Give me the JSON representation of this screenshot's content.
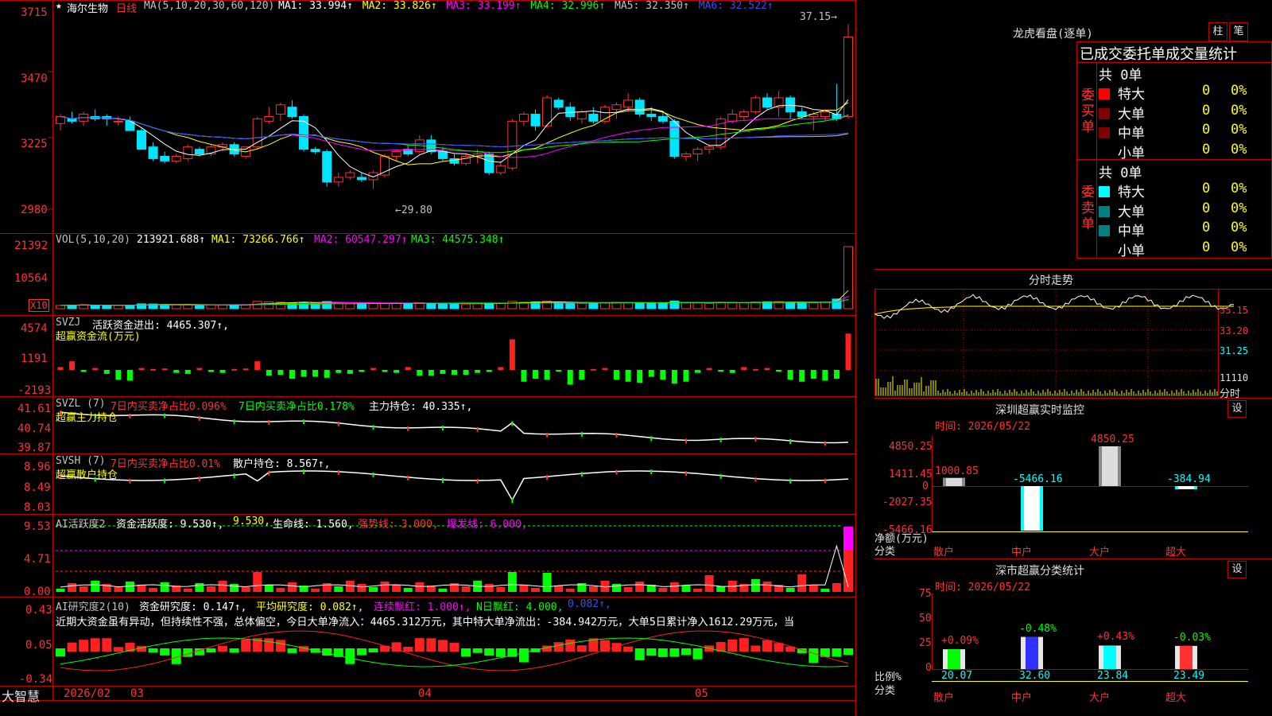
{
  "colors": {
    "up": "#ff3232",
    "down": "#00e5ff",
    "grid": "#c00000",
    "ma1": "#ffffff",
    "ma2": "#ffff00",
    "ma3": "#ff00ff",
    "ma4": "#00ff00",
    "ma5": "#c0c0c0",
    "ma6": "#3050ff"
  },
  "header": {
    "star": "★",
    "stock_name": "海尔生物",
    "period": "日线",
    "ma_label": "MA(5,10,20,30,60,120)",
    "ma_items": [
      {
        "label": "MA1: 33.994↑",
        "color": "#ffffff"
      },
      {
        "label": "MA2: 33.826↑",
        "color": "#ffff00"
      },
      {
        "label": "MA3: 33.199↑",
        "color": "#ff00ff"
      },
      {
        "label": "MA4: 32.996↑",
        "color": "#00ff00"
      },
      {
        "label": "MA5: 32.350↑",
        "color": "#c0c0c0"
      },
      {
        "label": "MA6: 32.522↑",
        "color": "#3050ff"
      }
    ],
    "high_mark": "37.15→",
    "low_mark": "←29.80"
  },
  "price_axis": {
    "ticks": [
      "3715",
      "3470",
      "3225",
      "2980"
    ]
  },
  "vol_panel": {
    "label": "VOL(5,10,20)",
    "value": "213921.688↑",
    "ma1": "MA1: 73266.766↑",
    "ma2": "MA2: 60547.297↑",
    "ma3": "MA3: 44575.348↑",
    "ticks": [
      "21392",
      "10564"
    ],
    "unit": "X10"
  },
  "svzj_panel": {
    "label": "SVZJ",
    "title": "活跃资金进出: 4465.307↑,",
    "subtitle": "超赢资金流(万元)",
    "ticks": [
      "4574",
      "1191",
      "-2193"
    ]
  },
  "svzl_panel": {
    "label": "SVZL (7)",
    "t1": "7日内买卖净占比0.096%",
    "t2": "7日内买卖净占比0.178%",
    "t3": "主力持仓: 40.335↑,",
    "subtitle": "超赢主力持仓",
    "ticks": [
      "41.61",
      "40.74",
      "39.87"
    ]
  },
  "svsh_panel": {
    "label": "SVSH (7)",
    "t1": "7日内买卖净占比0.01%",
    "t2": "散户持仓: 8.567↑,",
    "subtitle": "超赢散户持仓",
    "ticks": [
      "8.96",
      "8.49",
      "8.03"
    ]
  },
  "ai_active_panel": {
    "label": "AI活跃度2",
    "t1": "资金活跃度: 9.530↑,",
    "t2": "9.530,",
    "t3": "生命线: 1.560,",
    "t4": "强势线: 3.000,",
    "t5": "爆发线: 6.000,",
    "ticks": [
      "9.53",
      "4.71",
      "0.00"
    ]
  },
  "ai_research_panel": {
    "label": "AI研究度2(10)",
    "t1": "资金研究度: 0.147↑,",
    "t2": "平均研究度: 0.082↑,",
    "t3": "连续飘红: 1.000↑,",
    "t4": "N日飘红: 4.000,",
    "t5": "0.082↑,",
    "commentary": "近期大资金虽有异动，但持续性不强，总体偏空，今日大单净流入：4465.312万元，其中特大单净流出：-384.942万元，大单5日累计净入1612.29万元，当",
    "ticks": [
      "0.43",
      "0.05",
      "-0.34"
    ]
  },
  "date_axis": {
    "brand": "大智慧",
    "labels": [
      "2026/02",
      "03",
      "04",
      "05"
    ]
  },
  "chart_data": [
    {
      "type": "candlestick",
      "title": "海尔生物 日线",
      "ylim": [
        29.0,
        37.5
      ],
      "ohlc": [
        [
          32.9,
          33.3,
          32.6,
          33.2
        ],
        [
          33.1,
          33.4,
          32.9,
          33.0
        ],
        [
          33.0,
          33.4,
          32.8,
          33.3
        ],
        [
          33.2,
          33.5,
          33.0,
          33.1
        ],
        [
          33.2,
          33.3,
          32.8,
          33.1
        ],
        [
          33.0,
          33.2,
          32.8,
          33.0
        ],
        [
          33.0,
          33.2,
          32.6,
          32.6
        ],
        [
          32.6,
          32.7,
          31.8,
          31.8
        ],
        [
          31.9,
          32.1,
          31.3,
          31.4
        ],
        [
          31.5,
          31.7,
          31.2,
          31.3
        ],
        [
          31.3,
          31.6,
          31.2,
          31.5
        ],
        [
          31.4,
          32.0,
          31.3,
          31.9
        ],
        [
          31.8,
          31.9,
          31.5,
          31.6
        ],
        [
          31.6,
          32.0,
          31.5,
          31.9
        ],
        [
          31.9,
          32.1,
          31.7,
          32.0
        ],
        [
          32.0,
          32.1,
          31.5,
          31.6
        ],
        [
          31.5,
          31.9,
          31.4,
          31.9
        ],
        [
          31.9,
          33.2,
          31.8,
          33.1
        ],
        [
          33.0,
          33.6,
          32.9,
          33.2
        ],
        [
          33.3,
          33.8,
          33.0,
          33.7
        ],
        [
          33.6,
          33.9,
          33.1,
          33.2
        ],
        [
          33.2,
          33.3,
          31.7,
          31.8
        ],
        [
          31.8,
          31.9,
          31.6,
          31.7
        ],
        [
          31.7,
          31.8,
          30.2,
          30.4
        ],
        [
          30.4,
          30.8,
          30.2,
          30.6
        ],
        [
          30.6,
          30.9,
          30.5,
          30.8
        ],
        [
          30.6,
          30.8,
          30.4,
          30.5
        ],
        [
          30.5,
          30.9,
          30.1,
          30.8
        ],
        [
          30.7,
          31.6,
          30.6,
          31.5
        ],
        [
          31.5,
          31.8,
          31.3,
          31.7
        ],
        [
          31.8,
          32.0,
          31.5,
          31.6
        ],
        [
          31.7,
          32.4,
          31.6,
          32.2
        ],
        [
          32.2,
          32.4,
          31.6,
          31.7
        ],
        [
          31.7,
          31.9,
          31.3,
          31.4
        ],
        [
          31.4,
          31.6,
          31.1,
          31.2
        ],
        [
          31.2,
          31.6,
          31.1,
          31.5
        ],
        [
          31.5,
          31.8,
          31.2,
          31.6
        ],
        [
          31.6,
          31.7,
          30.7,
          30.8
        ],
        [
          30.8,
          31.3,
          30.7,
          31.1
        ],
        [
          31.0,
          33.1,
          30.9,
          33.0
        ],
        [
          33.0,
          33.4,
          32.8,
          33.3
        ],
        [
          33.3,
          33.5,
          32.6,
          32.8
        ],
        [
          32.8,
          34.1,
          32.7,
          34.0
        ],
        [
          33.9,
          34.0,
          33.5,
          33.6
        ],
        [
          33.6,
          33.8,
          33.0,
          33.2
        ],
        [
          33.1,
          33.5,
          32.9,
          33.4
        ],
        [
          33.3,
          33.6,
          32.9,
          33.0
        ],
        [
          33.0,
          33.7,
          32.9,
          33.6
        ],
        [
          33.5,
          33.8,
          33.1,
          33.7
        ],
        [
          33.6,
          34.2,
          33.4,
          33.9
        ],
        [
          33.9,
          34.0,
          33.2,
          33.3
        ],
        [
          33.3,
          33.6,
          33.0,
          33.2
        ],
        [
          33.2,
          33.4,
          32.9,
          33.0
        ],
        [
          33.0,
          33.1,
          31.4,
          31.5
        ],
        [
          31.5,
          31.7,
          31.3,
          31.6
        ],
        [
          31.6,
          31.9,
          31.3,
          31.8
        ],
        [
          31.8,
          32.0,
          31.6,
          31.9
        ],
        [
          31.9,
          33.2,
          31.8,
          33.1
        ],
        [
          33.0,
          33.5,
          32.9,
          33.3
        ],
        [
          33.2,
          33.5,
          33.0,
          33.4
        ],
        [
          33.4,
          34.1,
          33.3,
          34.0
        ],
        [
          34.0,
          34.2,
          33.5,
          33.6
        ],
        [
          33.6,
          34.3,
          33.2,
          34.0
        ],
        [
          34.0,
          34.1,
          33.1,
          33.4
        ],
        [
          33.4,
          33.6,
          33.1,
          33.2
        ],
        [
          33.2,
          33.4,
          32.6,
          33.3
        ],
        [
          33.2,
          33.5,
          33.0,
          33.4
        ],
        [
          33.3,
          34.6,
          33.0,
          33.1
        ],
        [
          33.2,
          37.15,
          33.1,
          36.6
        ]
      ]
    },
    {
      "type": "bar",
      "title": "VOL(5,10,20)",
      "values": [
        40,
        45,
        50,
        42,
        38,
        41,
        44,
        60,
        58,
        52,
        50,
        48,
        45,
        50,
        47,
        49,
        46,
        90,
        85,
        80,
        70,
        78,
        72,
        88,
        75,
        60,
        62,
        64,
        68,
        70,
        66,
        74,
        65,
        62,
        60,
        58,
        64,
        70,
        68,
        90,
        80,
        85,
        92,
        78,
        70,
        66,
        72,
        75,
        80,
        78,
        72,
        70,
        68,
        95,
        76,
        72,
        66,
        80,
        78,
        75,
        82,
        86,
        88,
        80,
        78,
        74,
        82,
        120,
        770
      ]
    },
    {
      "type": "bar",
      "title": "超赢资金流(万元)",
      "values": [
        300,
        900,
        -200,
        200,
        -400,
        -1000,
        -1100,
        200,
        100,
        150,
        -300,
        -400,
        200,
        -200,
        -300,
        100,
        150,
        900,
        -600,
        -500,
        -900,
        -700,
        -700,
        -800,
        -300,
        -400,
        -200,
        200,
        -200,
        -300,
        300,
        -600,
        -600,
        -400,
        -500,
        -500,
        -300,
        -200,
        300,
        3200,
        -1200,
        -900,
        -1000,
        -100,
        -1500,
        -1000,
        100,
        200,
        -1000,
        -1200,
        -1300,
        -700,
        -1000,
        -1400,
        -1200,
        -300,
        200,
        -100,
        -300,
        300,
        100,
        200,
        -100,
        -1000,
        -1200,
        -900,
        -1100,
        -900,
        3800
      ]
    }
  ],
  "side": {
    "dragon_title": "龙虎看盘(逐单)",
    "btn1": "柱",
    "btn2": "笔",
    "stat_title": "已成交委托单成交量统计",
    "buy_label": "委买单",
    "sell_label": "委卖单",
    "buy_total": "共 0单",
    "sell_total": "共 0单",
    "buy_rows": [
      {
        "name": "特大",
        "color": "#ff0000",
        "count": "0",
        "pct": "0%"
      },
      {
        "name": "大单",
        "color": "#800000",
        "count": "0",
        "pct": "0%"
      },
      {
        "name": "中单",
        "color": "#800000",
        "count": "0",
        "pct": "0%"
      },
      {
        "name": "小单",
        "color": "",
        "count": "0",
        "pct": "0%"
      }
    ],
    "sell_rows": [
      {
        "name": "特大",
        "color": "#00ffff",
        "count": "0",
        "pct": "0%"
      },
      {
        "name": "大单",
        "color": "#008080",
        "count": "0",
        "pct": "0%"
      },
      {
        "name": "中单",
        "color": "#008080",
        "count": "0",
        "pct": "0%"
      },
      {
        "name": "小单",
        "color": "",
        "count": "0",
        "pct": "0%"
      }
    ],
    "intraday_title": "分时走势",
    "intraday_ticks": [
      "35.15",
      "33.20",
      "31.25",
      "11110",
      "分时"
    ],
    "monitor_title": "深圳超赢实时监控",
    "monitor_btn": "设",
    "monitor_time": "时间: 2026/05/22",
    "monitor_ticks": [
      "4850.25",
      "1411.45",
      "0",
      "-2027.35",
      "-5466.16"
    ],
    "monitor_ylabel1": "净额(万元)",
    "monitor_ylabel2": "分类",
    "monitor_bars": [
      {
        "label": "1000.85",
        "value": 1000.85,
        "cat": "散户"
      },
      {
        "label": "-5466.16",
        "value": -5466.16,
        "cat": "中户"
      },
      {
        "label": "4850.25",
        "value": 4850.25,
        "cat": "大户"
      },
      {
        "label": "-384.94",
        "value": -384.94,
        "cat": "超大"
      }
    ],
    "class_title": "深市超赢分类统计",
    "class_btn": "设",
    "class_time": "时间: 2026/05/22",
    "class_ticks": [
      "75",
      "50",
      "25",
      "0"
    ],
    "class_ylabel1": "比例%",
    "class_ylabel2": "分类",
    "class_bars": [
      {
        "top": "+0.09%",
        "value": 20.07,
        "bottom": "20.07",
        "cat": "散户",
        "color": "#00ff00"
      },
      {
        "top": "-0.48%",
        "value": 32.6,
        "bottom": "32.60",
        "cat": "中户",
        "color": "#3030ff"
      },
      {
        "top": "+0.43%",
        "value": 23.84,
        "bottom": "23.84",
        "cat": "大户",
        "color": "#00ffff"
      },
      {
        "top": "-0.03%",
        "value": 23.49,
        "bottom": "23.49",
        "cat": "超大",
        "color": "#ff3232"
      }
    ]
  }
}
